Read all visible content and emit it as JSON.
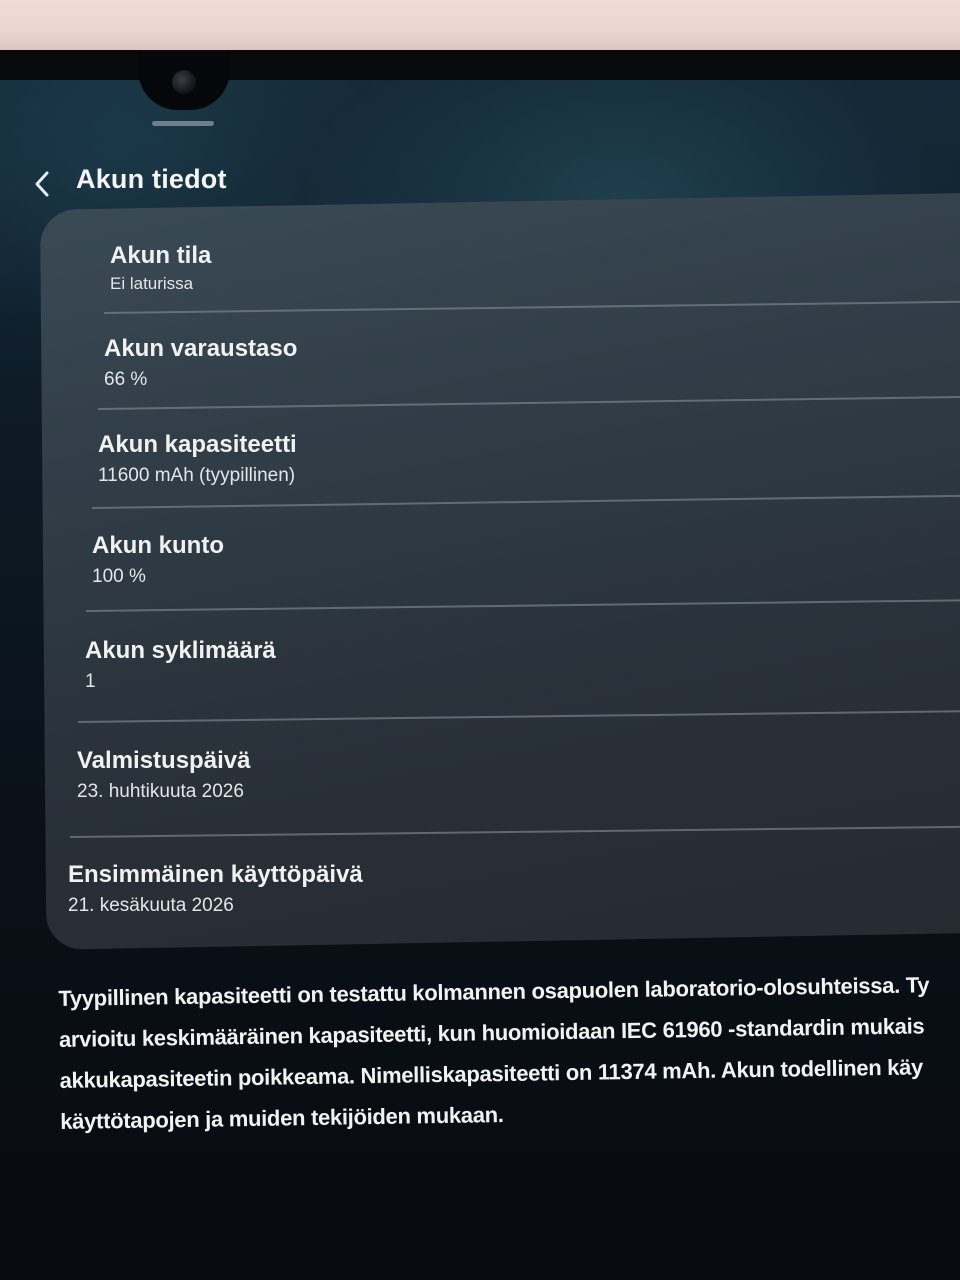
{
  "header": {
    "title": "Akun tiedot"
  },
  "rows": [
    {
      "title": "Akun tila",
      "value": "Ei laturissa"
    },
    {
      "title": "Akun varaustaso",
      "value": "66 %"
    },
    {
      "title": "Akun kapasiteetti",
      "value": "11600 mAh (tyypillinen)"
    },
    {
      "title": "Akun kunto",
      "value": "100 %"
    },
    {
      "title": "Akun syklimäärä",
      "value": "1"
    },
    {
      "title": "Valmistuspäivä",
      "value": "23. huhtikuuta 2026"
    },
    {
      "title": "Ensimmäinen käyttöpäivä",
      "value": "21. kesäkuuta 2026"
    }
  ],
  "footnote": {
    "lines": [
      "Tyypillinen kapasiteetti on testattu kolmannen osapuolen laboratorio-olosuhteissa. Ty",
      "arvioitu keskimääräinen kapasiteetti, kun huomioidaan IEC 61960 -standardin mukais",
      "akkukapasiteetin poikkeama. Nimelliskapasiteetti on 11374 mAh. Akun todellinen käy",
      "käyttötapojen ja muiden tekijöiden mukaan."
    ]
  },
  "icons": {
    "back": "chevron-left-icon"
  }
}
